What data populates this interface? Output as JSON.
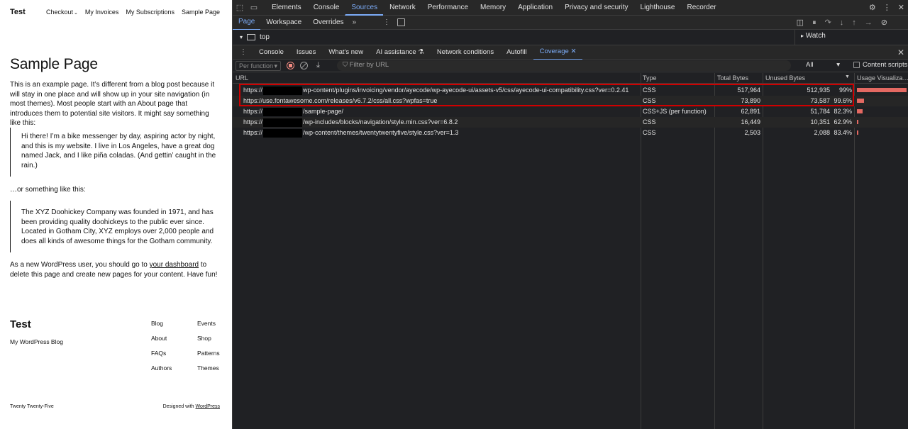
{
  "site": {
    "title": "Test",
    "nav": [
      {
        "label": "Checkout",
        "dropdown": true
      },
      {
        "label": "My Invoices"
      },
      {
        "label": "My Subscriptions"
      },
      {
        "label": "Sample Page"
      }
    ],
    "page_title": "Sample Page",
    "intro": "This is an example page. It’s different from a blog post because it will stay in one place and will show up in your site navigation (in most themes). Most people start with an About page that introduces them to potential site visitors. It might say something like this:",
    "quote1": "Hi there! I’m a bike messenger by day, aspiring actor by night, and this is my website. I live in Los Angeles, have a great dog named Jack, and I like piña coladas. (And gettin’ caught in the rain.)",
    "middle": "…or something like this:",
    "quote2": "The XYZ Doohickey Company was founded in 1971, and has been providing quality doohickeys to the public ever since. Located in Gotham City, XYZ employs over 2,000 people and does all kinds of awesome things for the Gotham community.",
    "outro_before": "As a new WordPress user, you should go to ",
    "outro_link": "your dashboard",
    "outro_after": " to delete this page and create new pages for your content. Have fun!",
    "footer": {
      "title": "Test",
      "tagline": "My WordPress Blog",
      "links": [
        "Blog",
        "Events",
        "About",
        "Shop",
        "FAQs",
        "Patterns",
        "Authors",
        "Themes"
      ],
      "theme": "Twenty Twenty-Five",
      "designed_with": "Designed with ",
      "designed_link": "WordPress"
    }
  },
  "devtools": {
    "main_tabs": [
      "Elements",
      "Console",
      "Sources",
      "Network",
      "Performance",
      "Memory",
      "Application",
      "Privacy and security",
      "Lighthouse",
      "Recorder"
    ],
    "active_main_tab": "Sources",
    "sources_tabs": [
      "Page",
      "Workspace",
      "Overrides"
    ],
    "active_sources_tab": "Page",
    "frame": "top",
    "watch_label": "Watch",
    "drawer_tabs": [
      "Console",
      "Issues",
      "What's new",
      "AI assistance",
      "Network conditions",
      "Autofill",
      "Coverage"
    ],
    "active_drawer_tab": "Coverage",
    "coverage": {
      "mode_placeholder": "Per function",
      "filter_placeholder": "Filter by URL",
      "type_filter": "All",
      "content_scripts_label": "Content scripts",
      "columns": [
        "URL",
        "Type",
        "Total Bytes",
        "Unused Bytes",
        "Usage Visualiza…"
      ],
      "rows": [
        {
          "url_prefix": "https://",
          "redacted": true,
          "url_suffix": "wp-content/plugins/invoicing/vendor/ayecode/wp-ayecode-ui/assets-v5/css/ayecode-ui-compatibility.css?ver=0.2.41",
          "type": "CSS",
          "total": "517,964",
          "unused": "512,935",
          "pct": "99%",
          "total_num": 517964,
          "unused_fraction": 0.99
        },
        {
          "url_prefix": "https://use.fontawesome.com/releases/v6.7.2/css/all.css?wpfas=true",
          "redacted": false,
          "url_suffix": "",
          "type": "CSS",
          "total": "73,890",
          "unused": "73,587",
          "pct": "99.6%",
          "total_num": 73890,
          "unused_fraction": 0.996
        },
        {
          "url_prefix": "https://",
          "redacted": true,
          "url_suffix": "/sample-page/",
          "type": "CSS+JS (per function)",
          "total": "62,891",
          "unused": "51,784",
          "pct": "82.3%",
          "total_num": 62891,
          "unused_fraction": 0.823
        },
        {
          "url_prefix": "https://",
          "redacted": true,
          "url_suffix": "/wp-includes/blocks/navigation/style.min.css?ver=6.8.2",
          "type": "CSS",
          "total": "16,449",
          "unused": "10,351",
          "pct": "62.9%",
          "total_num": 16449,
          "unused_fraction": 0.629
        },
        {
          "url_prefix": "https://",
          "redacted": true,
          "url_suffix": "/wp-content/themes/twentytwentyfive/style.css?ver=1.3",
          "type": "CSS",
          "total": "2,503",
          "unused": "2,088",
          "pct": "83.4%",
          "total_num": 2503,
          "unused_fraction": 0.834
        }
      ]
    },
    "colors": {
      "accent": "#7cacf8",
      "unused_bar": "#e46962",
      "highlight": "#d00000"
    }
  }
}
